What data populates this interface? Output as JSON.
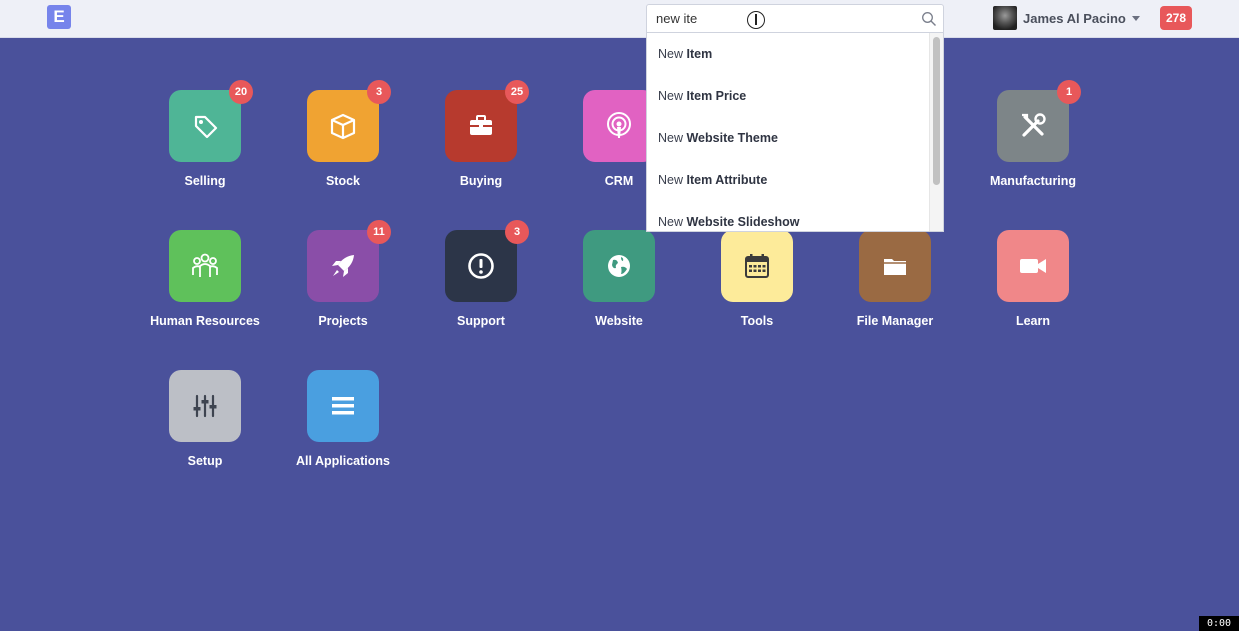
{
  "navbar": {
    "logo_letter": "E",
    "search_value": "new ite",
    "user_name": "James Al Pacino",
    "notification_count": "278"
  },
  "dropdown": {
    "items": [
      {
        "prefix": "New ",
        "name": "Item"
      },
      {
        "prefix": "New ",
        "name": "Item Price"
      },
      {
        "prefix": "New ",
        "name": "Website Theme"
      },
      {
        "prefix": "New ",
        "name": "Item Attribute"
      },
      {
        "prefix": "New ",
        "name": "Website Slideshow"
      }
    ]
  },
  "apps": [
    {
      "label": "Selling",
      "badge": "20",
      "color": "#4fb596",
      "icon": "tag-icon"
    },
    {
      "label": "Stock",
      "badge": "3",
      "color": "#f0a332",
      "icon": "box-icon"
    },
    {
      "label": "Buying",
      "badge": "25",
      "color": "#b73a2e",
      "icon": "briefcase-icon"
    },
    {
      "label": "CRM",
      "badge": "",
      "color": "#e162c2",
      "icon": "broadcast-icon"
    },
    {
      "label": "Manufacturing",
      "badge": "1",
      "color": "#7d8588",
      "icon": "tools-icon"
    },
    {
      "label": "Human Resources",
      "badge": "",
      "color": "#5fc15b",
      "icon": "people-icon"
    },
    {
      "label": "Projects",
      "badge": "11",
      "color": "#8a4ea8",
      "icon": "rocket-icon"
    },
    {
      "label": "Support",
      "badge": "3",
      "color": "#2c3548",
      "icon": "alert-icon"
    },
    {
      "label": "Website",
      "badge": "",
      "color": "#3f9a80",
      "icon": "globe-icon"
    },
    {
      "label": "Tools",
      "badge": "",
      "color": "#fdeb9a",
      "icon": "calendar-icon"
    },
    {
      "label": "File Manager",
      "badge": "",
      "color": "#9a6a43",
      "icon": "folder-icon"
    },
    {
      "label": "Learn",
      "badge": "",
      "color": "#f08789",
      "icon": "video-icon"
    },
    {
      "label": "Setup",
      "badge": "",
      "color": "#bcbfc6",
      "icon": "sliders-icon"
    },
    {
      "label": "All Applications",
      "badge": "",
      "color": "#4a9fe0",
      "icon": "menu-icon"
    }
  ],
  "recorder_clock": "0:00"
}
